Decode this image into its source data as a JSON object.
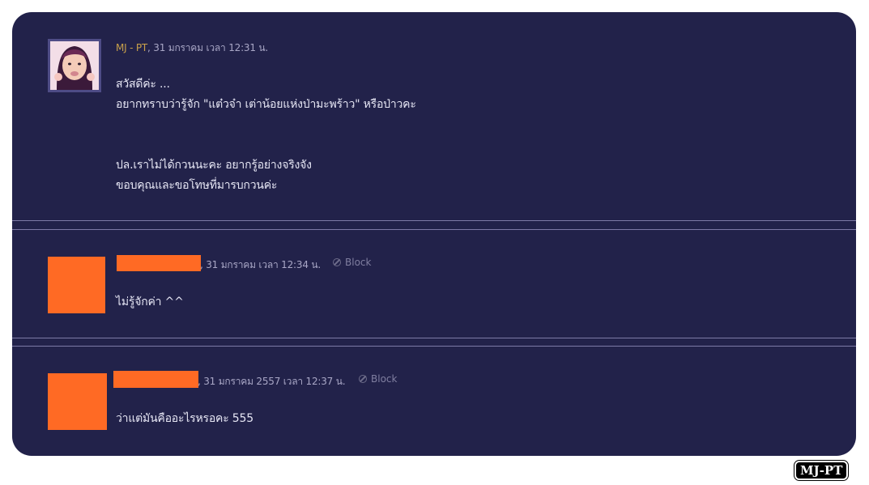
{
  "posts": [
    {
      "author": "MJ - PT",
      "timestamp": ", 31 มกราคม เวลา 12:31 น.",
      "lines": [
        "สวัสดีค่ะ ...",
        "อยากทราบว่ารู้จัก \"แต๋วจ๋า  เต่าน้อยแห่งป่ามะพร้าว\" หรือป่าวคะ",
        "ปล.เราไม่ได้กวนนะคะ อยากรู้อย่างจริงจัง",
        "ขอบคุณและขอโทษที่มารบกวนค่ะ"
      ]
    },
    {
      "author": "",
      "timestamp": ", 31 มกราคม เวลา 12:34 น.",
      "block_label": "Block",
      "lines": [
        "ไม่รู้จักค่า ^^"
      ]
    },
    {
      "author": "",
      "timestamp": ", 31 มกราคม 2557 เวลา 12:37 น.",
      "block_label": "Block",
      "lines": [
        "ว่าแต่มันคืออะไรหรอคะ 555"
      ]
    }
  ],
  "watermark": "MJ-PT",
  "colors": {
    "panel": "#22224a",
    "redaction": "#ff6a24",
    "author": "#c9a14a"
  },
  "icons": {
    "block": "block-circle-icon"
  }
}
